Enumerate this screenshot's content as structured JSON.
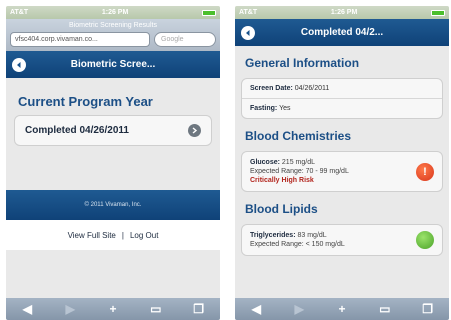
{
  "left": {
    "status": {
      "carrier": "AT&T",
      "time": "1:26 PM"
    },
    "browser": {
      "page_title": "Biometric Screening Results",
      "url": "vfsc404.corp.vivaman.co...",
      "search_placeholder": "Google"
    },
    "nav": {
      "title": "Biometric Scree..."
    },
    "section_heading": "Current Program Year",
    "item_label": "Completed 04/26/2011",
    "footer_copyright": "© 2011 Vivaman, Inc.",
    "footer_links": {
      "full_site": "View Full Site",
      "separator": "|",
      "logout": "Log Out"
    },
    "toolbar": [
      "◀",
      "▶",
      "+",
      "▭",
      "❐"
    ]
  },
  "right": {
    "status": {
      "carrier": "AT&T",
      "time": "1:26 PM"
    },
    "nav": {
      "title": "Completed 04/2..."
    },
    "general": {
      "heading": "General Information",
      "screen_date_label": "Screen Date:",
      "screen_date_value": "04/26/2011",
      "fasting_label": "Fasting:",
      "fasting_value": "Yes"
    },
    "chemistries": {
      "heading": "Blood Chemistries",
      "glucose_label": "Glucose:",
      "glucose_value": "215 mg/dL",
      "glucose_range": "Expected Range: 70 - 99 mg/dL",
      "glucose_flag": "Critically High Risk",
      "alert_symbol": "!"
    },
    "lipids": {
      "heading": "Blood Lipids",
      "trig_label": "Triglycerides:",
      "trig_value": "83 mg/dL",
      "trig_range": "Expected Range: < 150 mg/dL"
    },
    "toolbar": [
      "◀",
      "▶",
      "+",
      "▭",
      "❐"
    ]
  },
  "colors": {
    "nav_blue": "#17508a",
    "heading_blue": "#1c4f86",
    "alert_red": "#d8351b",
    "ok_green": "#4aa228"
  }
}
